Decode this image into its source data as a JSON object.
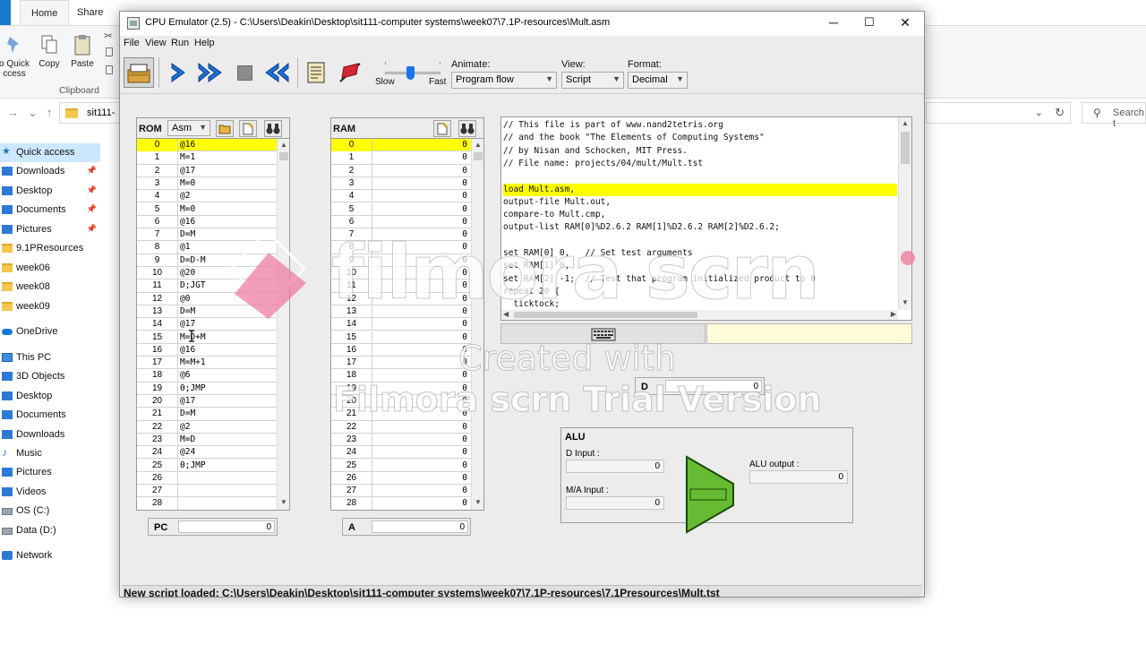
{
  "explorer": {
    "ribbon_tabs": [
      "e",
      "Home",
      "Share"
    ],
    "ribbon_buttons": [
      "o Quick ccess",
      "Copy",
      "Paste"
    ],
    "ribbon_group": "Clipboard",
    "address": "sit111-",
    "search_placeholder": "Search t",
    "sidebar": [
      {
        "label": "Quick access",
        "icon": "star-icon",
        "pinned": false,
        "selected": true
      },
      {
        "label": "Downloads",
        "icon": "download-icon",
        "pinned": true
      },
      {
        "label": "Desktop",
        "icon": "desktop-icon",
        "pinned": true
      },
      {
        "label": "Documents",
        "icon": "documents-icon",
        "pinned": true
      },
      {
        "label": "Pictures",
        "icon": "pictures-icon",
        "pinned": true
      },
      {
        "label": "9.1PResources",
        "icon": "folder-icon",
        "pinned": false
      },
      {
        "label": "week06",
        "icon": "folder-icon",
        "pinned": false
      },
      {
        "label": "week08",
        "icon": "folder-icon",
        "pinned": false
      },
      {
        "label": "week09",
        "icon": "folder-icon",
        "pinned": false
      },
      {
        "label": "OneDrive",
        "icon": "cloud-icon",
        "pinned": false
      },
      {
        "label": "This PC",
        "icon": "pc-icon",
        "pinned": false
      },
      {
        "label": "3D Objects",
        "icon": "cube-icon",
        "pinned": false
      },
      {
        "label": "Desktop",
        "icon": "desktop-icon",
        "pinned": false
      },
      {
        "label": "Documents",
        "icon": "documents-icon",
        "pinned": false
      },
      {
        "label": "Downloads",
        "icon": "download-icon",
        "pinned": false
      },
      {
        "label": "Music",
        "icon": "music-icon",
        "pinned": false
      },
      {
        "label": "Pictures",
        "icon": "pictures-icon",
        "pinned": false
      },
      {
        "label": "Videos",
        "icon": "videos-icon",
        "pinned": false
      },
      {
        "label": "OS (C:)",
        "icon": "drive-icon",
        "pinned": false
      },
      {
        "label": "Data (D:)",
        "icon": "drive-icon",
        "pinned": false
      },
      {
        "label": "Network",
        "icon": "network-icon",
        "pinned": false
      }
    ]
  },
  "window": {
    "title": "CPU Emulator (2.5) - C:\\Users\\Deakin\\Desktop\\sit111-computer systems\\week07\\7.1P-resources\\Mult.asm",
    "controls": [
      "─",
      "☐",
      "✕"
    ]
  },
  "menu": [
    "File",
    "View",
    "Run",
    "Help"
  ],
  "toolbar": {
    "slow_label": "Slow",
    "fast_label": "Fast",
    "speed_level": 0.45,
    "animate_label": "Animate:",
    "animate_value": "Program flow",
    "view_label": "View:",
    "view_value": "Script",
    "format_label": "Format:",
    "format_value": "Decimal"
  },
  "rom": {
    "label": "ROM",
    "format": "Asm",
    "highlighted_row": 0,
    "rows": [
      [
        "0",
        "@16"
      ],
      [
        "1",
        "M=1"
      ],
      [
        "2",
        "@17"
      ],
      [
        "3",
        "M=0"
      ],
      [
        "4",
        "@2"
      ],
      [
        "5",
        "M=0"
      ],
      [
        "6",
        "@16"
      ],
      [
        "7",
        "D=M"
      ],
      [
        "8",
        "@1"
      ],
      [
        "9",
        "D=D-M"
      ],
      [
        "10",
        "@20"
      ],
      [
        "11",
        "D;JGT"
      ],
      [
        "12",
        "@0"
      ],
      [
        "13",
        "D=M"
      ],
      [
        "14",
        "@17"
      ],
      [
        "15",
        "M=D+M"
      ],
      [
        "16",
        "@16"
      ],
      [
        "17",
        "M=M+1"
      ],
      [
        "18",
        "@6"
      ],
      [
        "19",
        "0;JMP"
      ],
      [
        "20",
        "@17"
      ],
      [
        "21",
        "D=M"
      ],
      [
        "22",
        "@2"
      ],
      [
        "23",
        "M=D"
      ],
      [
        "24",
        "@24"
      ],
      [
        "25",
        "0;JMP"
      ],
      [
        "26",
        ""
      ],
      [
        "27",
        ""
      ],
      [
        "28",
        ""
      ]
    ]
  },
  "ram": {
    "label": "RAM",
    "highlighted_row": 0,
    "rows": [
      [
        "0",
        "0"
      ],
      [
        "1",
        "0"
      ],
      [
        "2",
        "0"
      ],
      [
        "3",
        "0"
      ],
      [
        "4",
        "0"
      ],
      [
        "5",
        "0"
      ],
      [
        "6",
        "0"
      ],
      [
        "7",
        "0"
      ],
      [
        "8",
        "0"
      ],
      [
        "9",
        "0"
      ],
      [
        "10",
        "0"
      ],
      [
        "11",
        "0"
      ],
      [
        "12",
        "0"
      ],
      [
        "13",
        "0"
      ],
      [
        "14",
        "0"
      ],
      [
        "15",
        "0"
      ],
      [
        "16",
        "0"
      ],
      [
        "17",
        "0"
      ],
      [
        "18",
        "0"
      ],
      [
        "19",
        "0"
      ],
      [
        "20",
        "0"
      ],
      [
        "21",
        "0"
      ],
      [
        "22",
        "0"
      ],
      [
        "23",
        "0"
      ],
      [
        "24",
        "0"
      ],
      [
        "25",
        "0"
      ],
      [
        "26",
        "0"
      ],
      [
        "27",
        "0"
      ],
      [
        "28",
        "0"
      ]
    ]
  },
  "registers": {
    "pc_label": "PC",
    "pc_value": "0",
    "a_label": "A",
    "a_value": "0",
    "d_label": "D",
    "d_value": "0"
  },
  "script": {
    "highlighted_line": 5,
    "lines": [
      "// This file is part of www.nand2tetris.org",
      "// and the book \"The Elements of Computing Systems\"",
      "// by Nisan and Schocken, MIT Press.",
      "// File name: projects/04/mult/Mult.tst",
      "",
      "load Mult.asm,",
      "output-file Mult.out,",
      "compare-to Mult.cmp,",
      "output-list RAM[0]%D2.6.2 RAM[1]%D2.6.2 RAM[2]%D2.6.2;",
      "",
      "set RAM[0] 0,   // Set test arguments",
      "set RAM[1] 0,",
      "set RAM[2] -1;  // Test that program initialized product to 0",
      "repeat 20 {",
      "  ticktock;"
    ]
  },
  "alu": {
    "title": "ALU",
    "d_input_label": "D Input :",
    "d_input_value": "0",
    "ma_input_label": "M/A Input :",
    "ma_input_value": "0",
    "output_label": "ALU output :",
    "output_value": "0"
  },
  "status": "New script loaded: C:\\Users\\Deakin\\Desktop\\sit111-computer systems\\week07\\7.1P-resources\\7.1Presources\\Mult.tst",
  "watermark": {
    "brand": "filmora scrn",
    "line1": "Created with",
    "line2": "Filmora scrn Trial Version"
  },
  "colors": {
    "highlight": "#ffff00",
    "alu_green": "#66bb33",
    "arrow_blue": "#1e6fd6",
    "watermark_pink": "#ef7ea0"
  }
}
